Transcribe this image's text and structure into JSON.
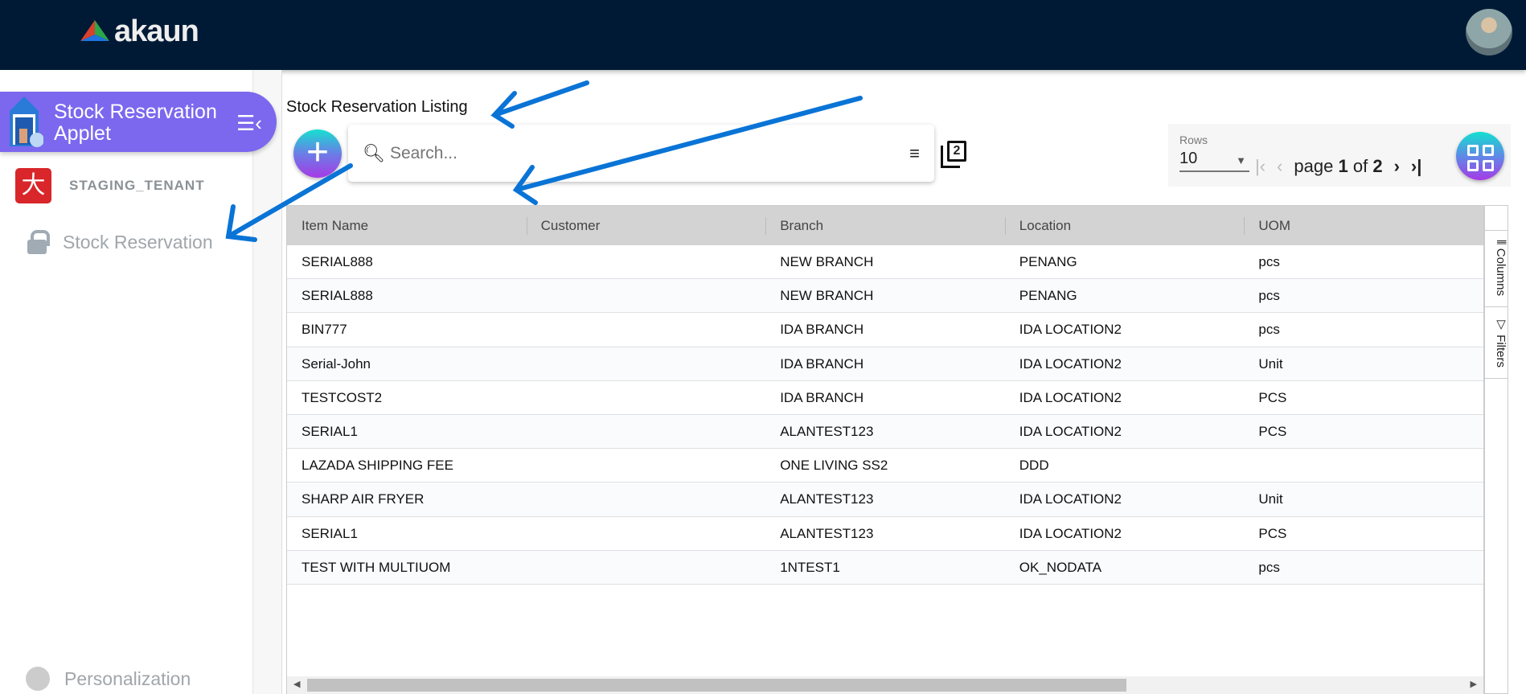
{
  "header": {
    "logo_text": "akaun",
    "avatar": "user-avatar"
  },
  "sidebar": {
    "applet_title": "Stock Reservation Applet",
    "tenant": "STAGING_TENANT",
    "items": [
      {
        "label": "Stock Reservation",
        "icon": "lock-icon"
      }
    ],
    "footer": {
      "label": "Personalization",
      "icon": "person-icon"
    }
  },
  "main": {
    "title": "Stock Reservation Listing",
    "search_placeholder": "Search...",
    "copy_badge": "2",
    "pager": {
      "rows_label": "Rows",
      "rows_value": "10",
      "page_label": "page",
      "current": "1",
      "of_label": "of",
      "total": "2"
    },
    "side_tabs": {
      "columns": "Columns",
      "filters": "Filters"
    },
    "columns": [
      "Item Name",
      "Customer",
      "Branch",
      "Location",
      "UOM"
    ],
    "rows": [
      [
        "SERIAL888",
        "",
        "NEW BRANCH",
        "PENANG",
        "pcs"
      ],
      [
        "SERIAL888",
        "",
        "NEW BRANCH",
        "PENANG",
        "pcs"
      ],
      [
        "BIN777",
        "",
        "IDA BRANCH",
        "IDA LOCATION2",
        "pcs"
      ],
      [
        "Serial-John",
        "",
        "IDA BRANCH",
        "IDA LOCATION2",
        "Unit"
      ],
      [
        "TESTCOST2",
        "",
        "IDA BRANCH",
        "IDA LOCATION2",
        "PCS"
      ],
      [
        "SERIAL1",
        "",
        "ALANTEST123",
        "IDA LOCATION2",
        "PCS"
      ],
      [
        "LAZADA SHIPPING FEE",
        "",
        "ONE LIVING SS2",
        "DDD",
        ""
      ],
      [
        "SHARP AIR FRYER",
        "",
        "ALANTEST123",
        "IDA LOCATION2",
        "Unit"
      ],
      [
        "SERIAL1",
        "",
        "ALANTEST123",
        "IDA LOCATION2",
        "PCS"
      ],
      [
        "TEST WITH MULTIUOM",
        "",
        "1NTEST1",
        "OK_NODATA",
        "pcs"
      ]
    ]
  },
  "colors": {
    "topbar": "#001a35",
    "applet": "#7b68ee",
    "annotation": "#0a74d6"
  }
}
